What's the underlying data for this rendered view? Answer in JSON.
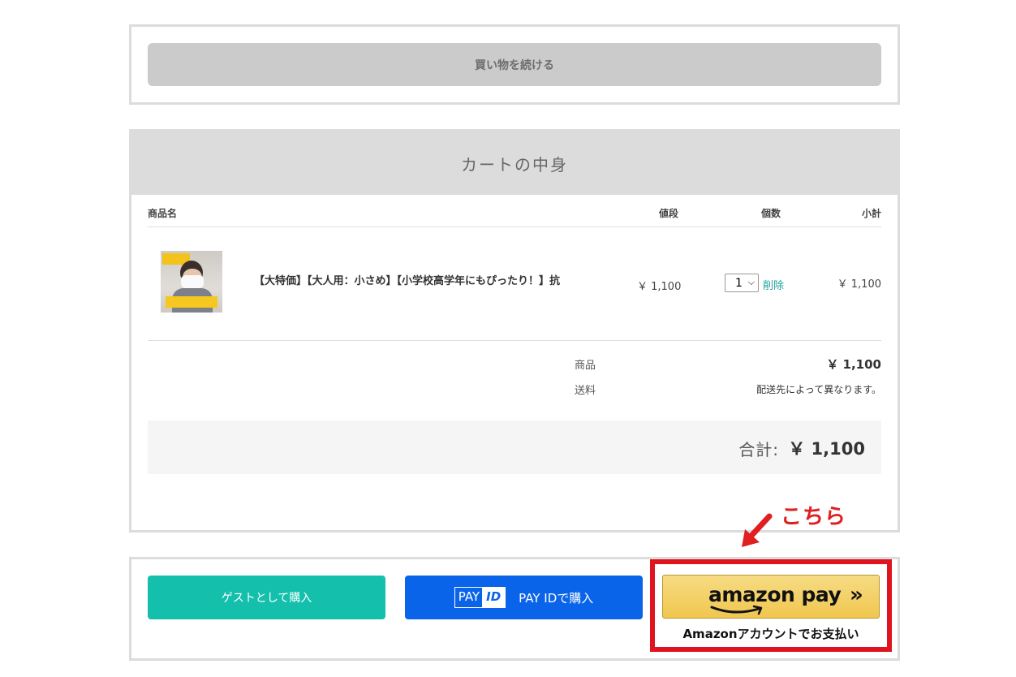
{
  "continue": {
    "label": "買い物を続ける"
  },
  "cart": {
    "title": "カートの中身",
    "headers": {
      "name": "商品名",
      "price": "値段",
      "qty": "個数",
      "subtotal": "小計"
    },
    "item": {
      "name": "【大特価】【大人用：小さめ】【小学校高学年にもぴったり！】抗",
      "price": "￥ 1,100",
      "qty": "1",
      "delete": "削除",
      "subtotal": "￥ 1,100"
    },
    "summary": {
      "goods_label": "商品",
      "goods_value": "￥ 1,100",
      "shipping_label": "送料",
      "shipping_value": "配送先によって異なります。"
    },
    "total": {
      "label": "合計:",
      "value": "￥ 1,100"
    }
  },
  "annotation": {
    "text": "こちら",
    "color": "#e02020"
  },
  "payment": {
    "guest_label": "ゲストとして購入",
    "payid_logo_left": "PAY",
    "payid_logo_right": "ID",
    "payid_label": "PAY IDで購入",
    "amazon_word": "amazon pay",
    "amazon_chevrons": "»",
    "amazon_caption": "Amazonアカウントでお支払い"
  },
  "colors": {
    "guest": "#14c0ab",
    "payid": "#0a64ea",
    "highlight": "#e0141e",
    "delete_link": "#1aa39a"
  }
}
